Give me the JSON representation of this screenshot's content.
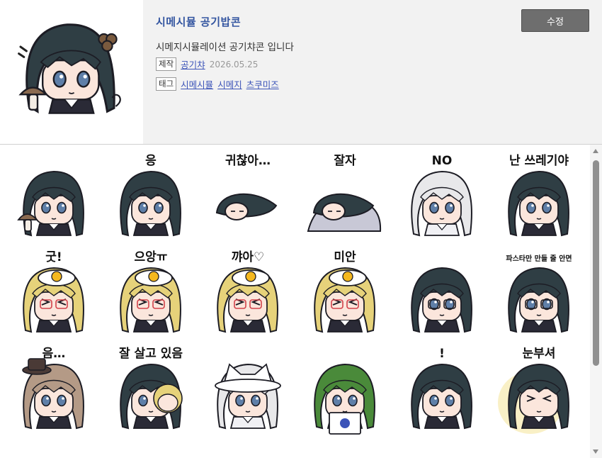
{
  "pack": {
    "title": "시메시뮬 공기밥콘",
    "description": "시메지시뮬레이션 공기챠콘 입니다",
    "creator_tag": "제작",
    "creator": "공기챠",
    "date": "2026.05.25",
    "tags_tag": "태그",
    "tags": [
      "시메시뮬",
      "시메지",
      "츠쿠미즈"
    ],
    "edit_label": "수정"
  },
  "stickers": [
    {
      "hair": "#2f3e44",
      "caption": "",
      "kind": "mushroom"
    },
    {
      "hair": "#2f3e44",
      "caption": "응",
      "kind": "plain"
    },
    {
      "hair": "#2f3e44",
      "caption": "귀찮아…",
      "kind": "lying"
    },
    {
      "hair": "#2f3e44",
      "caption": "잘자",
      "kind": "sleep"
    },
    {
      "hair": "#e8e8ea",
      "caption": "NO",
      "kind": "plain"
    },
    {
      "hair": "#2f3e44",
      "caption": "난 쓰레기야",
      "kind": "plain"
    },
    {
      "hair": "#e6d27a",
      "caption": "굿!",
      "kind": "egg"
    },
    {
      "hair": "#e6d27a",
      "caption": "으앙ㅠ",
      "kind": "egg"
    },
    {
      "hair": "#e6d27a",
      "caption": "꺄아♡",
      "kind": "egg"
    },
    {
      "hair": "#e6d27a",
      "caption": "미안",
      "kind": "egg"
    },
    {
      "hair": "#2f3e44",
      "caption": "",
      "kind": "glasses"
    },
    {
      "hair": "#2f3e44",
      "caption": "파스타만 만들 줄 안면 살아갈 수 있어",
      "kind": "glasses"
    },
    {
      "hair": "#b49a86",
      "caption": "음…",
      "kind": "hat"
    },
    {
      "hair": "#2f3e44",
      "caption": "잘 살고 있음",
      "kind": "duo"
    },
    {
      "hair": "#e8e8ea",
      "caption": "",
      "kind": "cat"
    },
    {
      "hair": "#4a8a3a",
      "caption": "",
      "kind": "sign"
    },
    {
      "hair": "#2f3e44",
      "caption": "!",
      "kind": "twin"
    },
    {
      "hair": "#2f3e44",
      "caption": "눈부셔",
      "kind": "glow"
    }
  ]
}
